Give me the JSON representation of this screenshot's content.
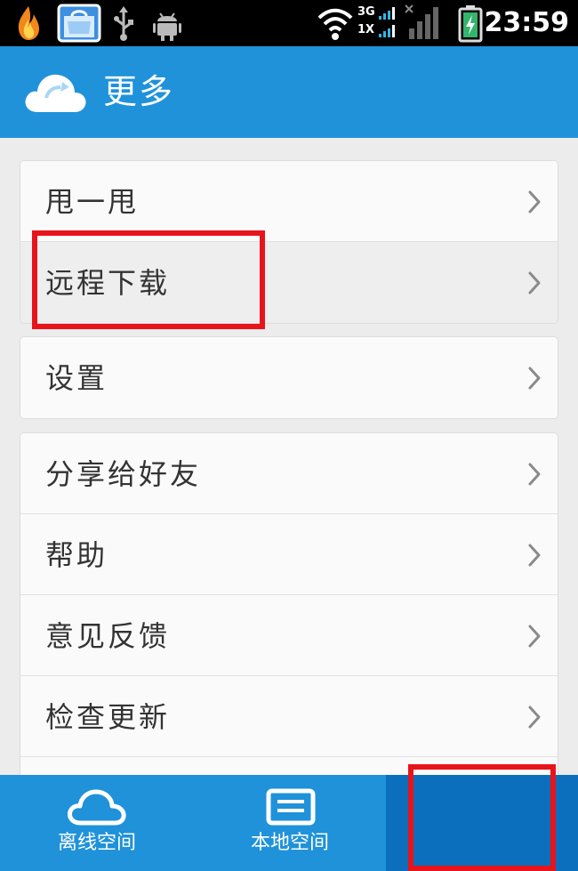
{
  "status_bar": {
    "time": "23:59",
    "network_top": "3G",
    "network_bottom": "1X",
    "icons": [
      "flame-app-icon",
      "store-bag-icon",
      "usb-icon",
      "android-debug-icon",
      "wifi-icon",
      "signal-icon",
      "battery-charging-icon"
    ]
  },
  "header": {
    "logo_icon": "cloud-logo-icon",
    "title": "更多"
  },
  "menu": {
    "groups": [
      {
        "items": [
          {
            "label": "甩一甩"
          },
          {
            "label": "远程下载"
          }
        ]
      },
      {
        "items": [
          {
            "label": "设置"
          }
        ]
      },
      {
        "items": [
          {
            "label": "分享给好友"
          },
          {
            "label": "帮助"
          },
          {
            "label": "意见反馈"
          },
          {
            "label": "检查更新"
          },
          {
            "label": ""
          }
        ]
      }
    ]
  },
  "bottom_nav": {
    "tabs": [
      {
        "label": "离线空间",
        "icon": "cloud-outline-icon"
      },
      {
        "label": "本地空间",
        "icon": "document-icon"
      },
      {
        "label": "",
        "icon": ""
      }
    ]
  },
  "colors": {
    "primary": "#1f92da",
    "active_tab": "#0b6fbd",
    "annotation": "#e8141b",
    "background": "#ececec"
  }
}
